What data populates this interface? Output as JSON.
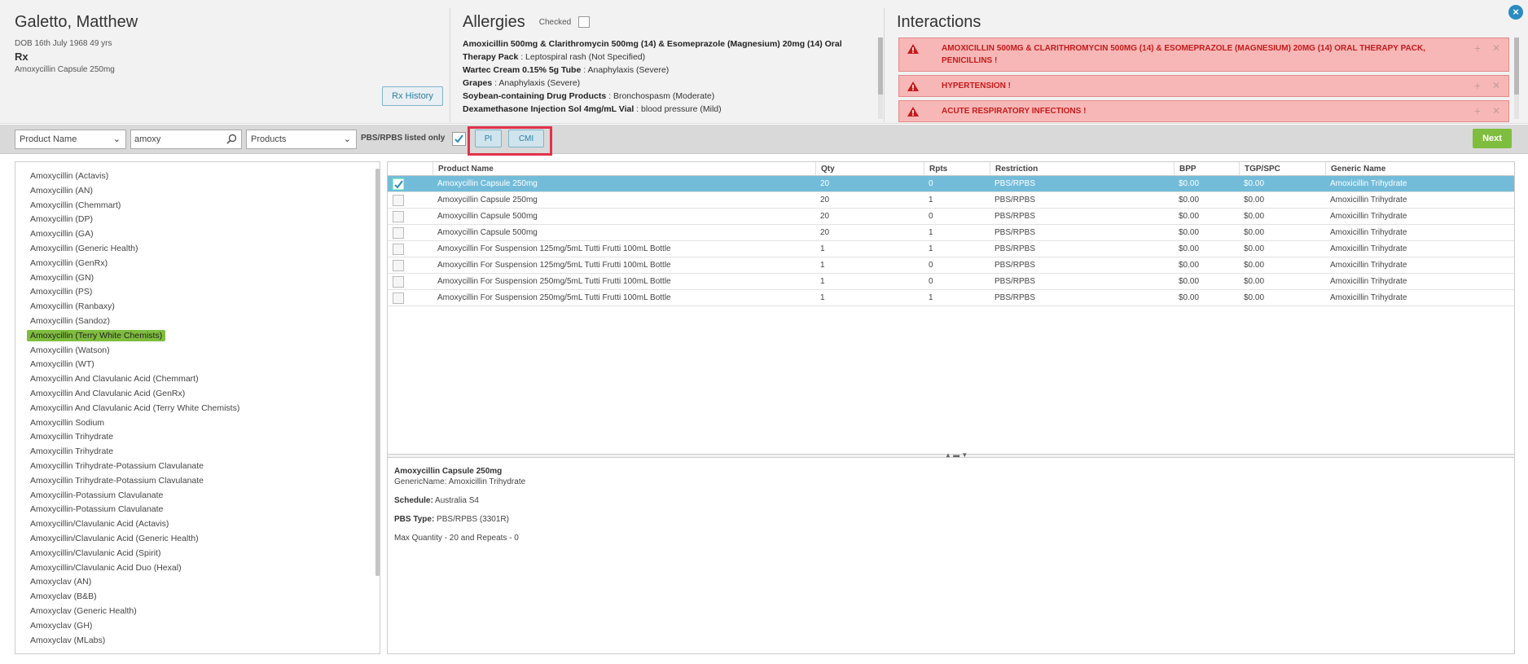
{
  "patient": {
    "name": "Galetto, Matthew",
    "dob": "DOB 16th July 1968 49 yrs",
    "rx_label": "Rx",
    "rx_drug": "Amoxycillin Capsule 250mg",
    "rx_history_label": "Rx History"
  },
  "allergies": {
    "title": "Allergies",
    "checked_label": "Checked",
    "items": [
      {
        "name": "Amoxicillin 500mg & Clarithromycin 500mg (14) & Esomeprazole (Magnesium) 20mg (14) Oral",
        "reaction": ""
      },
      {
        "name": "Therapy Pack",
        "reaction": " : Leptospiral rash (Not Specified)"
      },
      {
        "name": "Wartec Cream 0.15% 5g Tube",
        "reaction": " : Anaphylaxis (Severe)"
      },
      {
        "name": "Grapes",
        "reaction": " : Anaphylaxis (Severe)"
      },
      {
        "name": "Soybean-containing Drug Products",
        "reaction": " : Bronchospasm (Moderate)"
      },
      {
        "name": "Dexamethasone Injection Sol 4mg/mL Vial",
        "reaction": " : blood pressure (Mild)"
      }
    ]
  },
  "interactions": {
    "title": "Interactions",
    "items": [
      {
        "text": "AMOXICILLIN 500MG & CLARITHROMYCIN 500MG (14) & ESOMEPRAZOLE (MAGNESIUM) 20MG (14) ORAL THERAPY PACK, PENICILLINS !"
      },
      {
        "text": "HYPERTENSION !"
      },
      {
        "text": "ACUTE RESPIRATORY INFECTIONS !"
      }
    ]
  },
  "toolbar": {
    "search_by": "Product Name",
    "search_value": "amoxy",
    "filter": "Products",
    "pbs_label": "PBS/RPBS listed only",
    "pi_label": "PI",
    "cmi_label": "CMI",
    "next_label": "Next"
  },
  "product_list": [
    "Amoxycillin (Actavis)",
    "Amoxycillin (AN)",
    "Amoxycillin (Chemmart)",
    "Amoxycillin (DP)",
    "Amoxycillin (GA)",
    "Amoxycillin (Generic Health)",
    "Amoxycillin (GenRx)",
    "Amoxycillin (GN)",
    "Amoxycillin (PS)",
    "Amoxycillin (Ranbaxy)",
    "Amoxycillin (Sandoz)",
    "Amoxycillin (Terry White Chemists)",
    "Amoxycillin (Watson)",
    "Amoxycillin (WT)",
    "Amoxycillin And Clavulanic Acid (Chemmart)",
    "Amoxycillin And Clavulanic Acid (GenRx)",
    "Amoxycillin And Clavulanic Acid (Terry White Chemists)",
    "Amoxycillin Sodium",
    "Amoxycillin Trihydrate",
    "Amoxycillin Trihydrate",
    "Amoxycillin Trihydrate-Potassium Clavulanate",
    "Amoxycillin Trihydrate-Potassium Clavulanate",
    "Amoxycillin-Potassium Clavulanate",
    "Amoxycillin-Potassium Clavulanate",
    "Amoxycillin/Clavulanic Acid (Actavis)",
    "Amoxycillin/Clavulanic Acid (Generic Health)",
    "Amoxycillin/Clavulanic Acid (Spirit)",
    "Amoxycillin/Clavulanic Acid Duo (Hexal)",
    "Amoxyclav (AN)",
    "Amoxyclav (B&B)",
    "Amoxyclav (Generic Health)",
    "Amoxyclav (GH)",
    "Amoxyclav (MLabs)"
  ],
  "table": {
    "headers": [
      "Product Name",
      "Qty",
      "Rpts",
      "Restriction",
      "BPP",
      "TGP/SPC",
      "Generic Name"
    ],
    "rows": [
      [
        "Amoxycillin Capsule 250mg",
        "20",
        "0",
        "PBS/RPBS",
        "$0.00",
        "$0.00",
        "Amoxicillin Trihydrate"
      ],
      [
        "Amoxycillin Capsule 250mg",
        "20",
        "1",
        "PBS/RPBS",
        "$0.00",
        "$0.00",
        "Amoxicillin Trihydrate"
      ],
      [
        "Amoxycillin Capsule 500mg",
        "20",
        "0",
        "PBS/RPBS",
        "$0.00",
        "$0.00",
        "Amoxicillin Trihydrate"
      ],
      [
        "Amoxycillin Capsule 500mg",
        "20",
        "1",
        "PBS/RPBS",
        "$0.00",
        "$0.00",
        "Amoxicillin Trihydrate"
      ],
      [
        "Amoxycillin For Suspension 125mg/5mL Tutti Frutti 100mL Bottle",
        "1",
        "1",
        "PBS/RPBS",
        "$0.00",
        "$0.00",
        "Amoxicillin Trihydrate"
      ],
      [
        "Amoxycillin For Suspension 125mg/5mL Tutti Frutti 100mL Bottle",
        "1",
        "0",
        "PBS/RPBS",
        "$0.00",
        "$0.00",
        "Amoxicillin Trihydrate"
      ],
      [
        "Amoxycillin For Suspension 250mg/5mL Tutti Frutti 100mL Bottle",
        "1",
        "0",
        "PBS/RPBS",
        "$0.00",
        "$0.00",
        "Amoxicillin Trihydrate"
      ],
      [
        "Amoxycillin For Suspension 250mg/5mL Tutti Frutti 100mL Bottle",
        "1",
        "1",
        "PBS/RPBS",
        "$0.00",
        "$0.00",
        "Amoxicillin Trihydrate"
      ]
    ]
  },
  "detail": {
    "title": "Amoxycillin Capsule 250mg",
    "generic": "GenericName: Amoxicillin Trihydrate",
    "schedule_label": "Schedule:",
    "schedule_value": " Australia S4",
    "pbs_type_label": "PBS Type:",
    "pbs_type_value": " PBS/RPBS (3301R)",
    "max_qty": "Max Quantity - 20 and Repeats - 0"
  },
  "colors": {
    "accent": "#2b8bc2",
    "selected_row": "#73bcd9",
    "selected_list_item": "#7fbd3e",
    "interaction_bg": "#f8b7b7",
    "interaction_text": "#c61a1a",
    "highlight": "#e0334a"
  }
}
